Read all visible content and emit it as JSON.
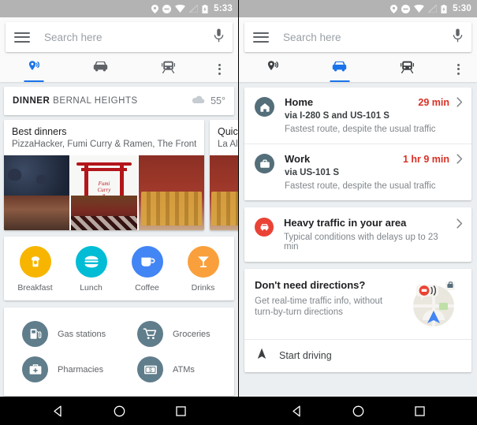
{
  "left_phone": {
    "status_bar": {
      "time": "5:33",
      "icons": [
        "location-pin-icon",
        "do-not-disturb-icon",
        "wifi-icon",
        "signal-off-icon",
        "battery-icon"
      ]
    },
    "search": {
      "placeholder": "Search here",
      "value": ""
    },
    "tabs": [
      {
        "name": "explore",
        "icon": "place-pin-icon",
        "active": true
      },
      {
        "name": "driving",
        "icon": "car-icon",
        "active": false
      },
      {
        "name": "transit",
        "icon": "train-icon",
        "active": false
      },
      {
        "name": "overflow",
        "icon": "more-vertical-icon",
        "active": false
      }
    ],
    "context_header": {
      "meal": "DINNER",
      "neighborhood": "BERNAL HEIGHTS",
      "weather_icon": "cloud-icon",
      "temperature": "55°"
    },
    "place_cards": [
      {
        "title": "Best dinners",
        "subtitle": "PizzaHacker, Fumi Curry & Ramen, The Front...",
        "photos": [
          "restaurant-interior-photo",
          "fumi-curry-ramen-photo",
          "dining-room-photo"
        ]
      },
      {
        "title": "Quick",
        "subtitle": "La Alt"
      }
    ],
    "categories": [
      {
        "label": "Breakfast",
        "icon": "toast-icon",
        "color": "#f7b500"
      },
      {
        "label": "Lunch",
        "icon": "burger-icon",
        "color": "#00bcd4"
      },
      {
        "label": "Coffee",
        "icon": "coffee-cup-icon",
        "color": "#4285f4"
      },
      {
        "label": "Drinks",
        "icon": "cocktail-icon",
        "color": "#f9a03c"
      }
    ],
    "services": [
      {
        "label": "Gas stations",
        "icon": "gas-pump-icon"
      },
      {
        "label": "Groceries",
        "icon": "shopping-cart-icon"
      },
      {
        "label": "Pharmacies",
        "icon": "pharmacy-cross-icon"
      },
      {
        "label": "ATMs",
        "icon": "banknote-icon"
      }
    ],
    "nav_bar": [
      "back-icon",
      "home-icon",
      "recents-icon"
    ]
  },
  "right_phone": {
    "status_bar": {
      "time": "5:30",
      "icons": [
        "location-pin-icon",
        "do-not-disturb-icon",
        "wifi-icon",
        "signal-off-icon",
        "battery-icon"
      ]
    },
    "search": {
      "placeholder": "Search here",
      "value": ""
    },
    "tabs": [
      {
        "name": "explore",
        "icon": "place-pin-icon",
        "active": false
      },
      {
        "name": "driving",
        "icon": "car-icon",
        "active": true
      },
      {
        "name": "transit",
        "icon": "train-icon",
        "active": false
      },
      {
        "name": "overflow",
        "icon": "more-vertical-icon",
        "active": false
      }
    ],
    "routes": [
      {
        "name": "Home",
        "icon": "house-icon",
        "duration": "29 min",
        "via": "via I-280 S and US-101 S",
        "note": "Fastest route, despite the usual traffic"
      },
      {
        "name": "Work",
        "icon": "briefcase-icon",
        "duration": "1 hr 9 min",
        "via": "via US-101 S",
        "note": "Fastest route, despite the usual traffic"
      }
    ],
    "traffic_alert": {
      "icon": "traffic-car-alert-icon",
      "title": "Heavy traffic in your area",
      "subtitle": "Typical conditions with delays up to 23 min"
    },
    "promo": {
      "title": "Don't need directions?",
      "subtitle": "Get real-time traffic info, without turn-by-turn directions",
      "art": "driving-mode-map-illustration",
      "action_label": "Start driving",
      "action_icon": "navigation-arrow-icon"
    },
    "nav_bar": [
      "back-icon",
      "home-icon",
      "recents-icon"
    ]
  },
  "colors": {
    "accent": "#1a73e8",
    "alert_red": "#d93025",
    "panel_bg": "#eceff1",
    "status_bar": "#b3b3b3",
    "service_circle": "#607d8b"
  }
}
